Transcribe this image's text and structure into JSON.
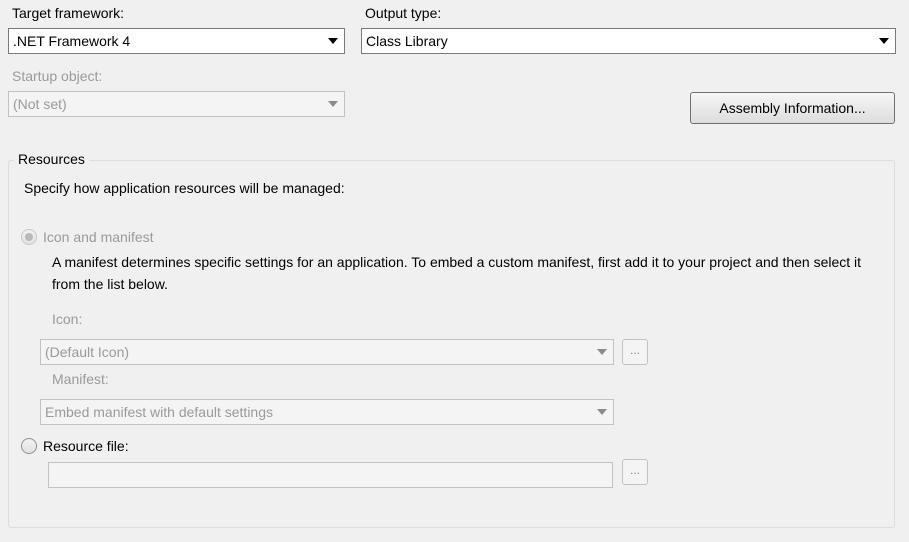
{
  "target_framework": {
    "label": "Target framework:",
    "value": ".NET Framework 4"
  },
  "output_type": {
    "label": "Output type:",
    "value": "Class Library"
  },
  "startup_object": {
    "label": "Startup object:",
    "value": "(Not set)"
  },
  "assembly_information_button": "Assembly Information...",
  "resources": {
    "title": "Resources",
    "instruction": "Specify how application resources will be managed:",
    "icon_and_manifest": {
      "label": "Icon and manifest",
      "description": "A manifest determines specific settings for an application. To embed a custom manifest, first add it to your project and then select it from the list below.",
      "icon_label": "Icon:",
      "icon_value": "(Default Icon)",
      "manifest_label": "Manifest:",
      "manifest_value": "Embed manifest with default settings",
      "browse_label": "..."
    },
    "resource_file": {
      "label": "Resource file:",
      "value": "",
      "browse_label": "..."
    }
  }
}
